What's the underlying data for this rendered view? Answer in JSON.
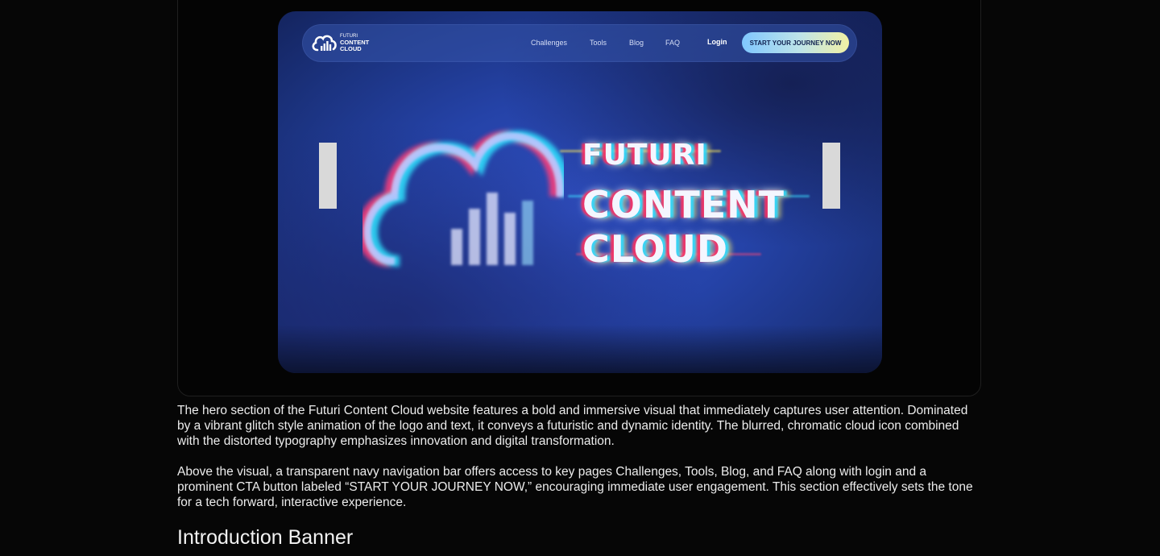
{
  "hero": {
    "nav": {
      "brand_small": "FUTURI",
      "brand_line2": "CONTENT",
      "brand_line3": "CLOUD",
      "links": [
        "Challenges",
        "Tools",
        "Blog",
        "FAQ"
      ],
      "login": "Login",
      "cta": "START YOUR JOURNEY NOW"
    },
    "headline": [
      "FUTURI",
      "CONTENT",
      "CLOUD"
    ],
    "colors": {
      "background": "#2543a8",
      "navbar": "#3454aa",
      "cta_start": "#7fc7ff",
      "cta_end": "#f1f1a4",
      "slider_controls": "#d9d9d9"
    }
  },
  "description": {
    "paragraph1": "The hero section of the Futuri Content Cloud website features a bold and immersive visual that immediately captures user attention. Dominated by a vibrant glitch style animation of the logo and text, it conveys a futuristic and dynamic identity. The blurred, chromatic cloud icon combined with the distorted typography emphasizes innovation and digital transformation.",
    "paragraph2": "Above the visual, a transparent navy navigation bar offers access to key pages Challenges, Tools, Blog, and FAQ along with login and a prominent CTA button labeled “START YOUR JOURNEY NOW,” encouraging immediate user engagement. This section effectively sets the tone for a tech forward, interactive experience."
  },
  "next_section": {
    "title": "Introduction Banner"
  },
  "icons": {
    "brand": "cloud-bars-icon",
    "prev": "slider-prev-control",
    "next": "slider-next-control"
  }
}
